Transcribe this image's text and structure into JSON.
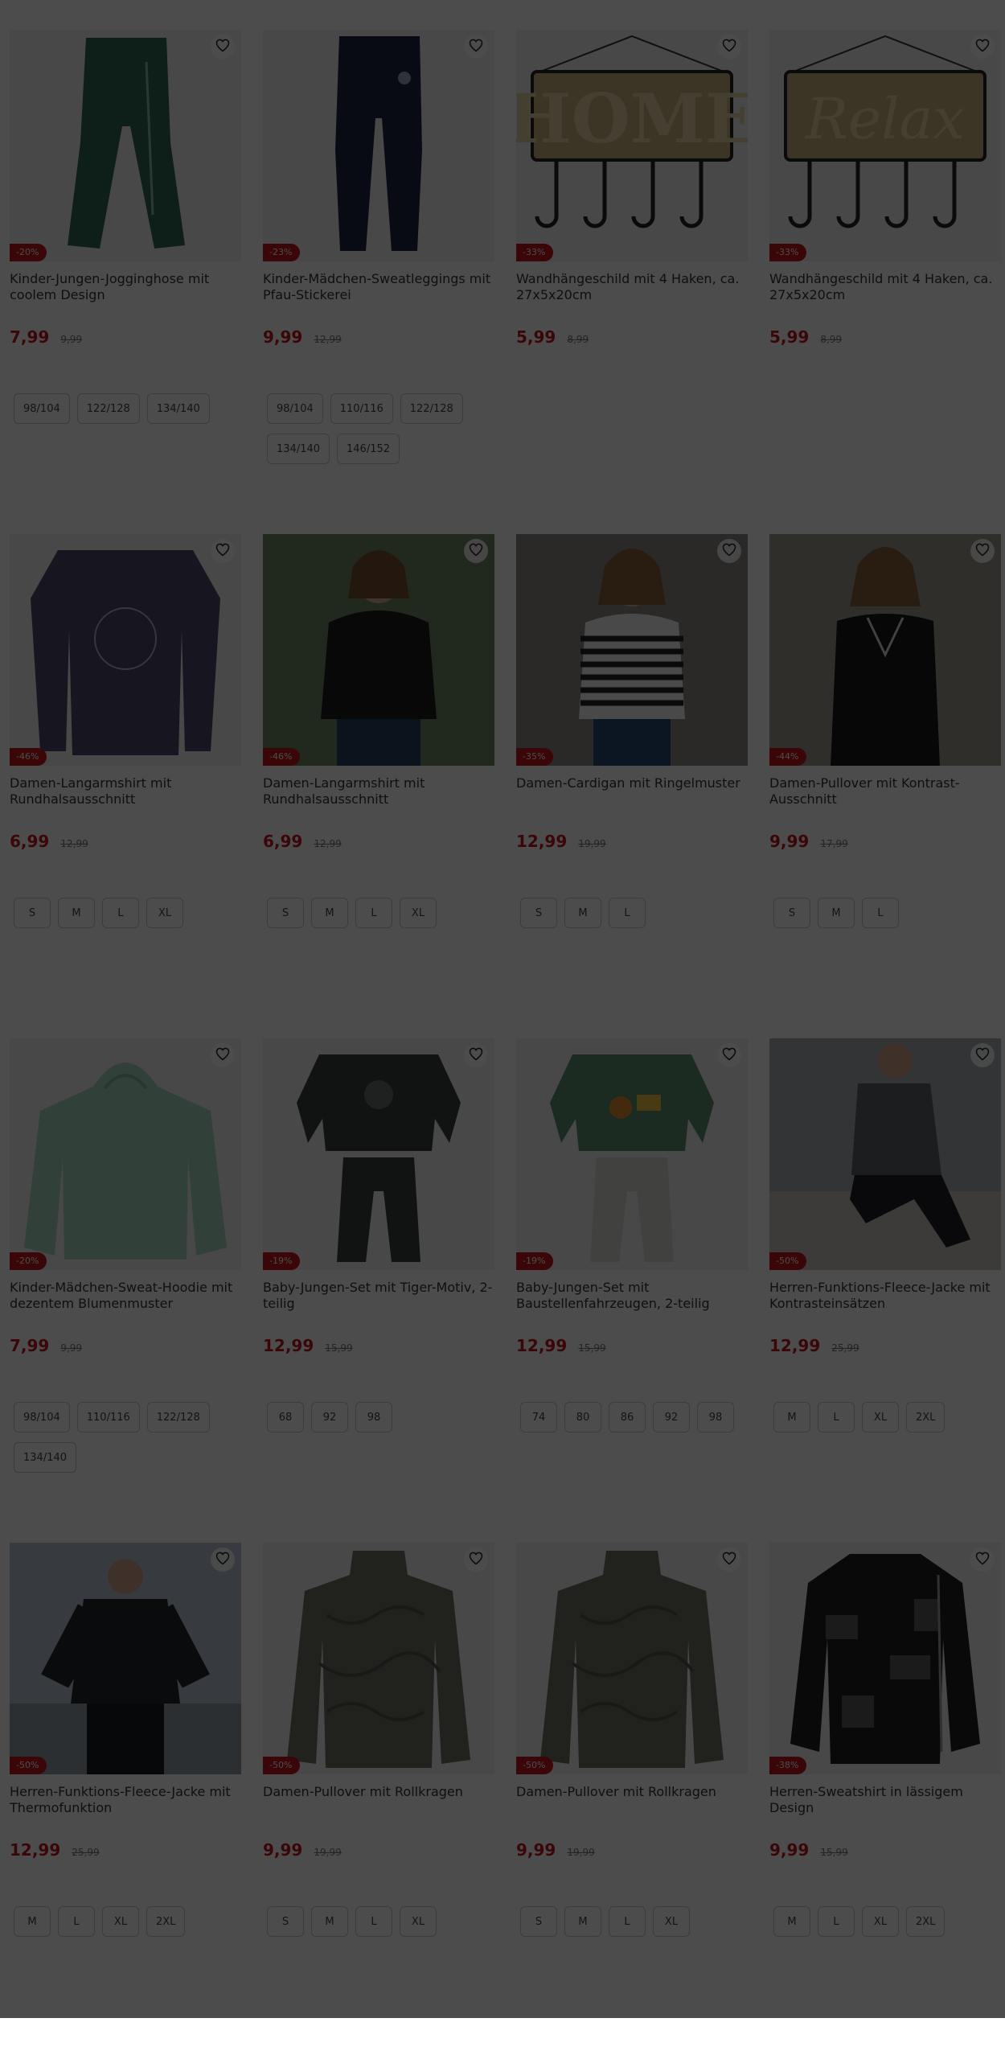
{
  "colors": {
    "accent": "#c4161c",
    "overlay": "rgba(0,0,0,0.7)"
  },
  "products": [
    {
      "title": "Kinder-Jungen-Jogginghose mit coolem Design",
      "discount": "-20%",
      "price": "7,99",
      "old_price": "9,99",
      "sizes": [
        "98/104",
        "122/128",
        "134/140"
      ],
      "art": "pants-green"
    },
    {
      "title": "Kinder-Mädchen-Sweatleggings mit Pfau-Stickerei",
      "discount": "-23%",
      "price": "9,99",
      "old_price": "12,99",
      "sizes": [
        "98/104",
        "110/116",
        "122/128",
        "134/140",
        "146/152"
      ],
      "art": "pants-navy"
    },
    {
      "title": "Wandhängeschild mit 4 Haken, ca. 27x5x20cm",
      "discount": "-33%",
      "price": "5,99",
      "old_price": "8,99",
      "sizes": [],
      "art": "sign-home"
    },
    {
      "title": "Wandhängeschild mit 4 Haken, ca. 27x5x20cm",
      "discount": "-33%",
      "price": "5,99",
      "old_price": "8,99",
      "sizes": [],
      "art": "sign-relax"
    },
    {
      "title": "Damen-Langarmshirt mit Rundhalsausschnitt",
      "discount": "-46%",
      "price": "6,99",
      "old_price": "12,99",
      "sizes": [
        "S",
        "M",
        "L",
        "XL"
      ],
      "art": "shirt-purple"
    },
    {
      "title": "Damen-Langarmshirt mit Rundhalsausschnitt",
      "discount": "-46%",
      "price": "6,99",
      "old_price": "12,99",
      "sizes": [
        "S",
        "M",
        "L",
        "XL"
      ],
      "art": "model-black"
    },
    {
      "title": "Damen-Cardigan mit Ringelmuster",
      "discount": "-35%",
      "price": "12,99",
      "old_price": "19,99",
      "sizes": [
        "S",
        "M",
        "L"
      ],
      "art": "model-stripes"
    },
    {
      "title": "Damen-Pullover mit Kontrast-Ausschnitt",
      "discount": "-44%",
      "price": "9,99",
      "old_price": "17,99",
      "sizes": [
        "S",
        "M",
        "L"
      ],
      "art": "model-vneck"
    },
    {
      "title": "Kinder-Mädchen-Sweat-Hoodie mit dezentem Blumenmuster",
      "discount": "-20%",
      "price": "7,99",
      "old_price": "9,99",
      "sizes": [
        "98/104",
        "110/116",
        "122/128",
        "134/140"
      ],
      "art": "hoodie-mint"
    },
    {
      "title": "Baby-Jungen-Set mit Tiger-Motiv, 2-teilig",
      "discount": "-19%",
      "price": "12,99",
      "old_price": "15,99",
      "sizes": [
        "68",
        "92",
        "98"
      ],
      "art": "set-grey"
    },
    {
      "title": "Baby-Jungen-Set mit Baustellenfahrzeugen, 2-teilig",
      "discount": "-19%",
      "price": "12,99",
      "old_price": "15,99",
      "sizes": [
        "74",
        "80",
        "86",
        "92",
        "98"
      ],
      "art": "set-green"
    },
    {
      "title": "Herren-Funktions-Fleece-Jacke mit Kontrasteinsätzen",
      "discount": "-50%",
      "price": "12,99",
      "old_price": "25,99",
      "sizes": [
        "M",
        "L",
        "XL",
        "2XL"
      ],
      "art": "model-man-sit"
    },
    {
      "title": "Herren-Funktions-Fleece-Jacke mit Thermofunktion",
      "discount": "-50%",
      "price": "12,99",
      "old_price": "25,99",
      "sizes": [
        "M",
        "L",
        "XL",
        "2XL"
      ],
      "art": "model-man-stand"
    },
    {
      "title": "Damen-Pullover mit Rollkragen",
      "discount": "-50%",
      "price": "9,99",
      "old_price": "19,99",
      "sizes": [
        "S",
        "M",
        "L",
        "XL"
      ],
      "art": "turtleneck"
    },
    {
      "title": "Damen-Pullover mit Rollkragen",
      "discount": "-50%",
      "price": "9,99",
      "old_price": "19,99",
      "sizes": [
        "S",
        "M",
        "L",
        "XL"
      ],
      "art": "turtleneck"
    },
    {
      "title": "Herren-Sweatshirt in lässigem Design",
      "discount": "-38%",
      "price": "9,99",
      "old_price": "15,99",
      "sizes": [
        "M",
        "L",
        "XL",
        "2XL"
      ],
      "art": "sweat-camo"
    }
  ]
}
